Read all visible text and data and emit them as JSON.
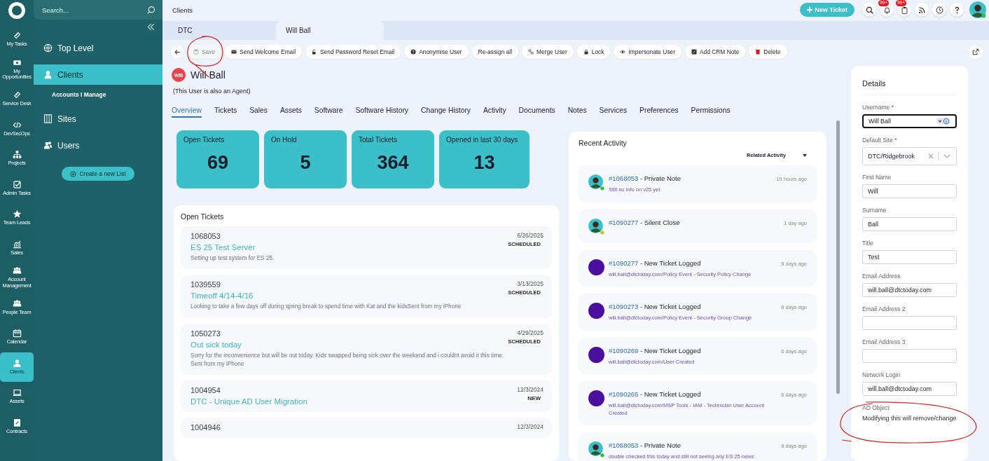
{
  "rail": {
    "items": [
      {
        "label": "My Tasks",
        "selected": false
      },
      {
        "label": "My Opportunities",
        "selected": false
      },
      {
        "label": "Service Desk",
        "selected": false
      },
      {
        "label": "DevSecOps",
        "selected": false
      },
      {
        "label": "Projects",
        "selected": false
      },
      {
        "label": "Admin Tasks",
        "selected": false
      },
      {
        "label": "Team Leads",
        "selected": false
      },
      {
        "label": "Sales",
        "selected": false
      },
      {
        "label": "Account Management",
        "selected": false
      },
      {
        "label": "People Team",
        "selected": false
      },
      {
        "label": "Calendar",
        "selected": false
      },
      {
        "label": "Clients",
        "selected": true
      },
      {
        "label": "Assets",
        "selected": false
      },
      {
        "label": "Contracts",
        "selected": false
      }
    ]
  },
  "sidebar": {
    "search": {
      "placeholder": "Search..."
    },
    "items": [
      {
        "label": "Top Level",
        "selected": false
      },
      {
        "label": "Clients",
        "selected": true,
        "children": [
          {
            "label": "Accounts I Manage",
            "selected": false
          }
        ]
      },
      {
        "label": "Sites",
        "selected": false
      },
      {
        "label": "Users",
        "selected": false
      }
    ],
    "create_button": "Create a new List"
  },
  "topbar": {
    "breadcrumb": "Clients",
    "new_ticket": "New Ticket",
    "badges": [
      "99+",
      "99+"
    ]
  },
  "record_tabs": [
    {
      "label": "DTC",
      "selected": false
    },
    {
      "label": "Will Ball",
      "selected": true
    }
  ],
  "actions": [
    {
      "label": "Save",
      "disabled": true
    },
    {
      "label": "Send Welcome Email",
      "disabled": false
    },
    {
      "label": "Send Password Reset Email",
      "disabled": false
    },
    {
      "label": "Anonymise User",
      "disabled": false
    },
    {
      "label": "Re-assign all",
      "disabled": false
    },
    {
      "label": "Merge User",
      "disabled": false
    },
    {
      "label": "Lock",
      "disabled": false
    },
    {
      "label": "Impersonate User",
      "disabled": false
    },
    {
      "label": "Add CRM Note",
      "disabled": false
    },
    {
      "label": "Delete",
      "disabled": false
    }
  ],
  "user": {
    "initials": "WB",
    "name": "Will Ball",
    "note": "(This User is also an Agent)"
  },
  "tabs": [
    {
      "label": "Overview",
      "selected": true
    },
    {
      "label": "Tickets",
      "selected": false
    },
    {
      "label": "Sales",
      "selected": false
    },
    {
      "label": "Assets",
      "selected": false
    },
    {
      "label": "Software",
      "selected": false
    },
    {
      "label": "Software History",
      "selected": false
    },
    {
      "label": "Change History",
      "selected": false
    },
    {
      "label": "Activity",
      "selected": false
    },
    {
      "label": "Documents",
      "selected": false
    },
    {
      "label": "Notes",
      "selected": false
    },
    {
      "label": "Services",
      "selected": false
    },
    {
      "label": "Preferences",
      "selected": false
    },
    {
      "label": "Permissions",
      "selected": false
    }
  ],
  "stats": [
    {
      "label": "Open Tickets",
      "value": "69"
    },
    {
      "label": "On Hold",
      "value": "5"
    },
    {
      "label": "Total Tickets",
      "value": "364"
    },
    {
      "label": "Opened in last 30 days",
      "value": "13"
    }
  ],
  "open_tickets": {
    "title": "Open Tickets",
    "tickets": [
      {
        "id": "1068053",
        "date": "6/26/2025",
        "status": "SCHEDULED",
        "title": "ES 25 Test Server",
        "summary": "Setting up test system for ES 25."
      },
      {
        "id": "1039559",
        "date": "3/13/2025",
        "status": "SCHEDULED",
        "title": "Timeoff 4/14-4/16",
        "summary": "Looking to take a few days off during spring break to spend time with Kat and the kidsSent from my iPhone"
      },
      {
        "id": "1050273",
        "date": "4/29/2025",
        "status": "SCHEDULED",
        "title": "Out sick today",
        "summary": "Sorry for the inconvenience but will be out today. Kids swapped being sick over the weekend and i couldnt avoid it this time. Sent from my iPhone"
      },
      {
        "id": "1004954",
        "date": "12/3/2024",
        "status": "NEW",
        "title": "DTC - Unique AD User Migration"
      },
      {
        "id": "1004946",
        "date": "12/3/2024"
      }
    ]
  },
  "activity": {
    "title": "Recent Activity",
    "filter": "Related Activity",
    "items": [
      {
        "ref": "#1068053",
        "event": "- Private Note",
        "detail": "Still no info on v25 yet.",
        "time": "19 hours ago",
        "kind": "photo",
        "color": "#2fbf4a"
      },
      {
        "ref": "#1090277",
        "event": "- Silent Close",
        "time": "1 day ago",
        "kind": "photo",
        "color": "#b5cf1f"
      },
      {
        "ref": "#1090277",
        "event": "- New Ticket Logged",
        "detail": "will.ball@dtctoday.com/Policy Event - Security Policy Change",
        "time": "5 days ago",
        "kind": "plain"
      },
      {
        "ref": "#1090273",
        "event": "- New Ticket Logged",
        "detail": "will.ball@dtctoday.com/Policy Event - Security Group Change",
        "time": "6 days ago",
        "kind": "plain"
      },
      {
        "ref": "#1090269",
        "event": "- New Ticket Logged",
        "detail": "will.ball@dtctoday.com/User Created",
        "time": "6 days ago",
        "kind": "plain"
      },
      {
        "ref": "#1090265",
        "event": "- New Ticket Logged",
        "detail": "will.ball@dtctoday.com/MSP Tools - IAM - Technician User Account Created",
        "time": "6 days ago",
        "kind": "plain"
      },
      {
        "ref": "#1068053",
        "event": "- Private Note",
        "detail": "double checked this today and still not seeing any ES 25 news",
        "time": "8 days ago",
        "kind": "photo",
        "color": "#2fbf4a"
      }
    ]
  },
  "details": {
    "title": "Details",
    "fields": [
      {
        "kind": "username",
        "label": "Username",
        "required_mark": "*",
        "value": "Will Ball"
      },
      {
        "kind": "select",
        "label": "Default Site",
        "required_mark": "*",
        "value": "DTC/Ridgebrook"
      },
      {
        "kind": "input",
        "label": "First Name",
        "value": "Will"
      },
      {
        "kind": "input",
        "label": "Surname",
        "value": "Ball"
      },
      {
        "kind": "input",
        "label": "Title",
        "value": "Test"
      },
      {
        "kind": "input",
        "label": "Email Address",
        "value": "will.ball@dtctoday.com"
      },
      {
        "kind": "input",
        "label": "Email Address 2"
      },
      {
        "kind": "input",
        "label": "Email Address 3"
      },
      {
        "kind": "input",
        "label": "Network Login",
        "value": "will.ball@dtctoday.com"
      },
      {
        "kind": "note",
        "label": "AD Object",
        "value": "Modifying this will remove/change"
      }
    ]
  }
}
